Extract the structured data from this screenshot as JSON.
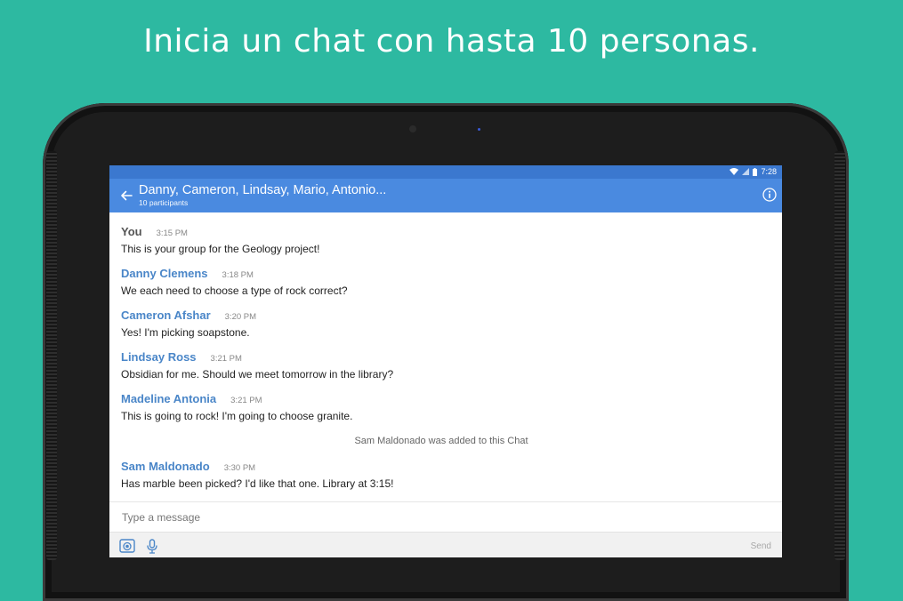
{
  "headline": "Inicia un chat con hasta 10 personas.",
  "status_bar": {
    "time": "7:28",
    "icons": [
      "wifi-icon",
      "signal-icon",
      "battery-icon"
    ]
  },
  "app_bar": {
    "title": "Danny, Cameron, Lindsay, Mario, Antonio...",
    "subtitle": "10 participants",
    "back_icon": "back-arrow-icon",
    "info_icon": "info-icon"
  },
  "messages": [
    {
      "sender": "You",
      "time": "3:15 PM",
      "text": "This is your group for the Geology project!"
    },
    {
      "sender": "Danny Clemens",
      "time": "3:18 PM",
      "text": "We each need to choose a type of rock correct?"
    },
    {
      "sender": "Cameron Afshar",
      "time": "3:20 PM",
      "text": "Yes! I'm picking soapstone."
    },
    {
      "sender": "Lindsay Ross",
      "time": "3:21 PM",
      "text": "Obsidian for me. Should we meet tomorrow in the library?"
    },
    {
      "sender": "Madeline Antonia",
      "time": "3:21 PM",
      "text": "This is going to rock! I'm going to choose granite."
    },
    {
      "sender": "Sam Maldonado",
      "time": "3:30 PM",
      "text": "Has marble been picked? I'd like that one. Library at 3:15!"
    }
  ],
  "system_message": "Sam Maldonado was added to this Chat",
  "composer": {
    "placeholder": "Type a message",
    "value": "",
    "send_label": "Send",
    "tools": [
      "camera-icon",
      "microphone-icon"
    ]
  },
  "colors": {
    "background": "#2db9a1",
    "status_bar": "#3b78cf",
    "app_bar": "#4a8ae0",
    "sender_name": "#4a86c8",
    "self_name": "#555555"
  }
}
